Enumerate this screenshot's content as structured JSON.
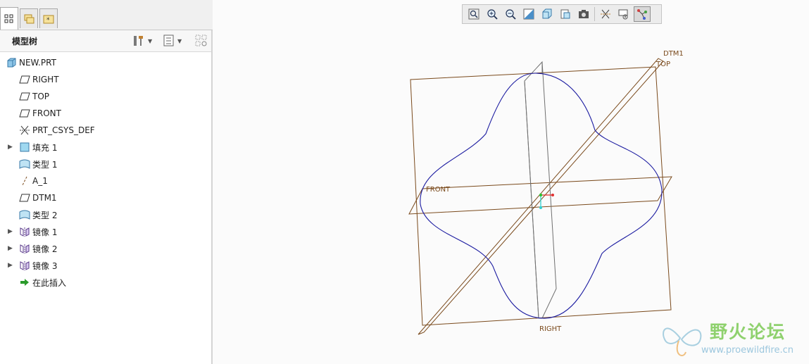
{
  "panel": {
    "title": "模型树",
    "tabs": [
      "model-tree-tab",
      "layers-tab",
      "favorites-tab"
    ]
  },
  "tree": {
    "items": [
      {
        "label": "NEW.PRT",
        "icon": "part-icon",
        "expandable": false
      },
      {
        "label": "RIGHT",
        "icon": "datum-plane-icon",
        "expandable": false
      },
      {
        "label": "TOP",
        "icon": "datum-plane-icon",
        "expandable": false
      },
      {
        "label": "FRONT",
        "icon": "datum-plane-icon",
        "expandable": false
      },
      {
        "label": "PRT_CSYS_DEF",
        "icon": "csys-icon",
        "expandable": false
      },
      {
        "label": "填充 1",
        "icon": "fill-icon",
        "expandable": true
      },
      {
        "label": "类型 1",
        "icon": "surface-icon",
        "expandable": false
      },
      {
        "label": "A_1",
        "icon": "axis-icon",
        "expandable": false
      },
      {
        "label": "DTM1",
        "icon": "datum-plane-icon",
        "expandable": false
      },
      {
        "label": "类型 2",
        "icon": "surface-icon",
        "expandable": false
      },
      {
        "label": "镜像 1",
        "icon": "mirror-icon",
        "expandable": true
      },
      {
        "label": "镜像 2",
        "icon": "mirror-icon",
        "expandable": true
      },
      {
        "label": "镜像 3",
        "icon": "mirror-icon",
        "expandable": true
      },
      {
        "label": "在此插入",
        "icon": "insert-here-arrow-icon",
        "expandable": false
      }
    ]
  },
  "viewport": {
    "plane_labels": {
      "dtm1": "DTM1",
      "top": "TOP",
      "front": "FRONT",
      "right": "RIGHT"
    },
    "toolbar": [
      "refit-icon",
      "zoom-in-icon",
      "zoom-out-icon",
      "repaint-icon",
      "display-style-icon",
      "saved-views-icon",
      "view-manager-icon",
      "datum-display-icon",
      "annotation-display-icon",
      "spin-center-icon"
    ]
  },
  "watermark": {
    "title": "野火论坛",
    "url": "www.proewildfire.cn"
  },
  "colors": {
    "plane": "#7a4a1c",
    "curve": "#1a1aa0",
    "surface": "#707070"
  }
}
